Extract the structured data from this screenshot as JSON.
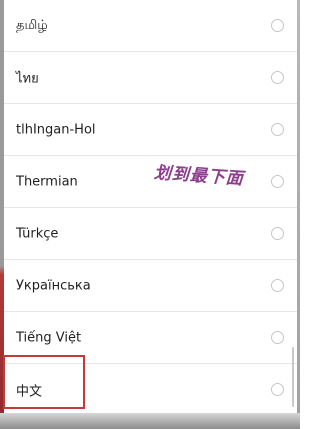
{
  "languages": [
    {
      "label": "தமிழ்",
      "selected": false
    },
    {
      "label": "ไทย",
      "selected": false
    },
    {
      "label": "tlhIngan-Hol",
      "selected": false
    },
    {
      "label": "Thermian",
      "selected": false
    },
    {
      "label": "Türkçe",
      "selected": false
    },
    {
      "label": "Українська",
      "selected": false
    },
    {
      "label": "Tiếng Việt",
      "selected": false
    },
    {
      "label": "中文",
      "selected": false
    }
  ],
  "annotation": {
    "text": "划到最下面",
    "color": "#8e3e8e"
  },
  "highlight": {
    "target": "中文",
    "color": "#c23b3b"
  }
}
